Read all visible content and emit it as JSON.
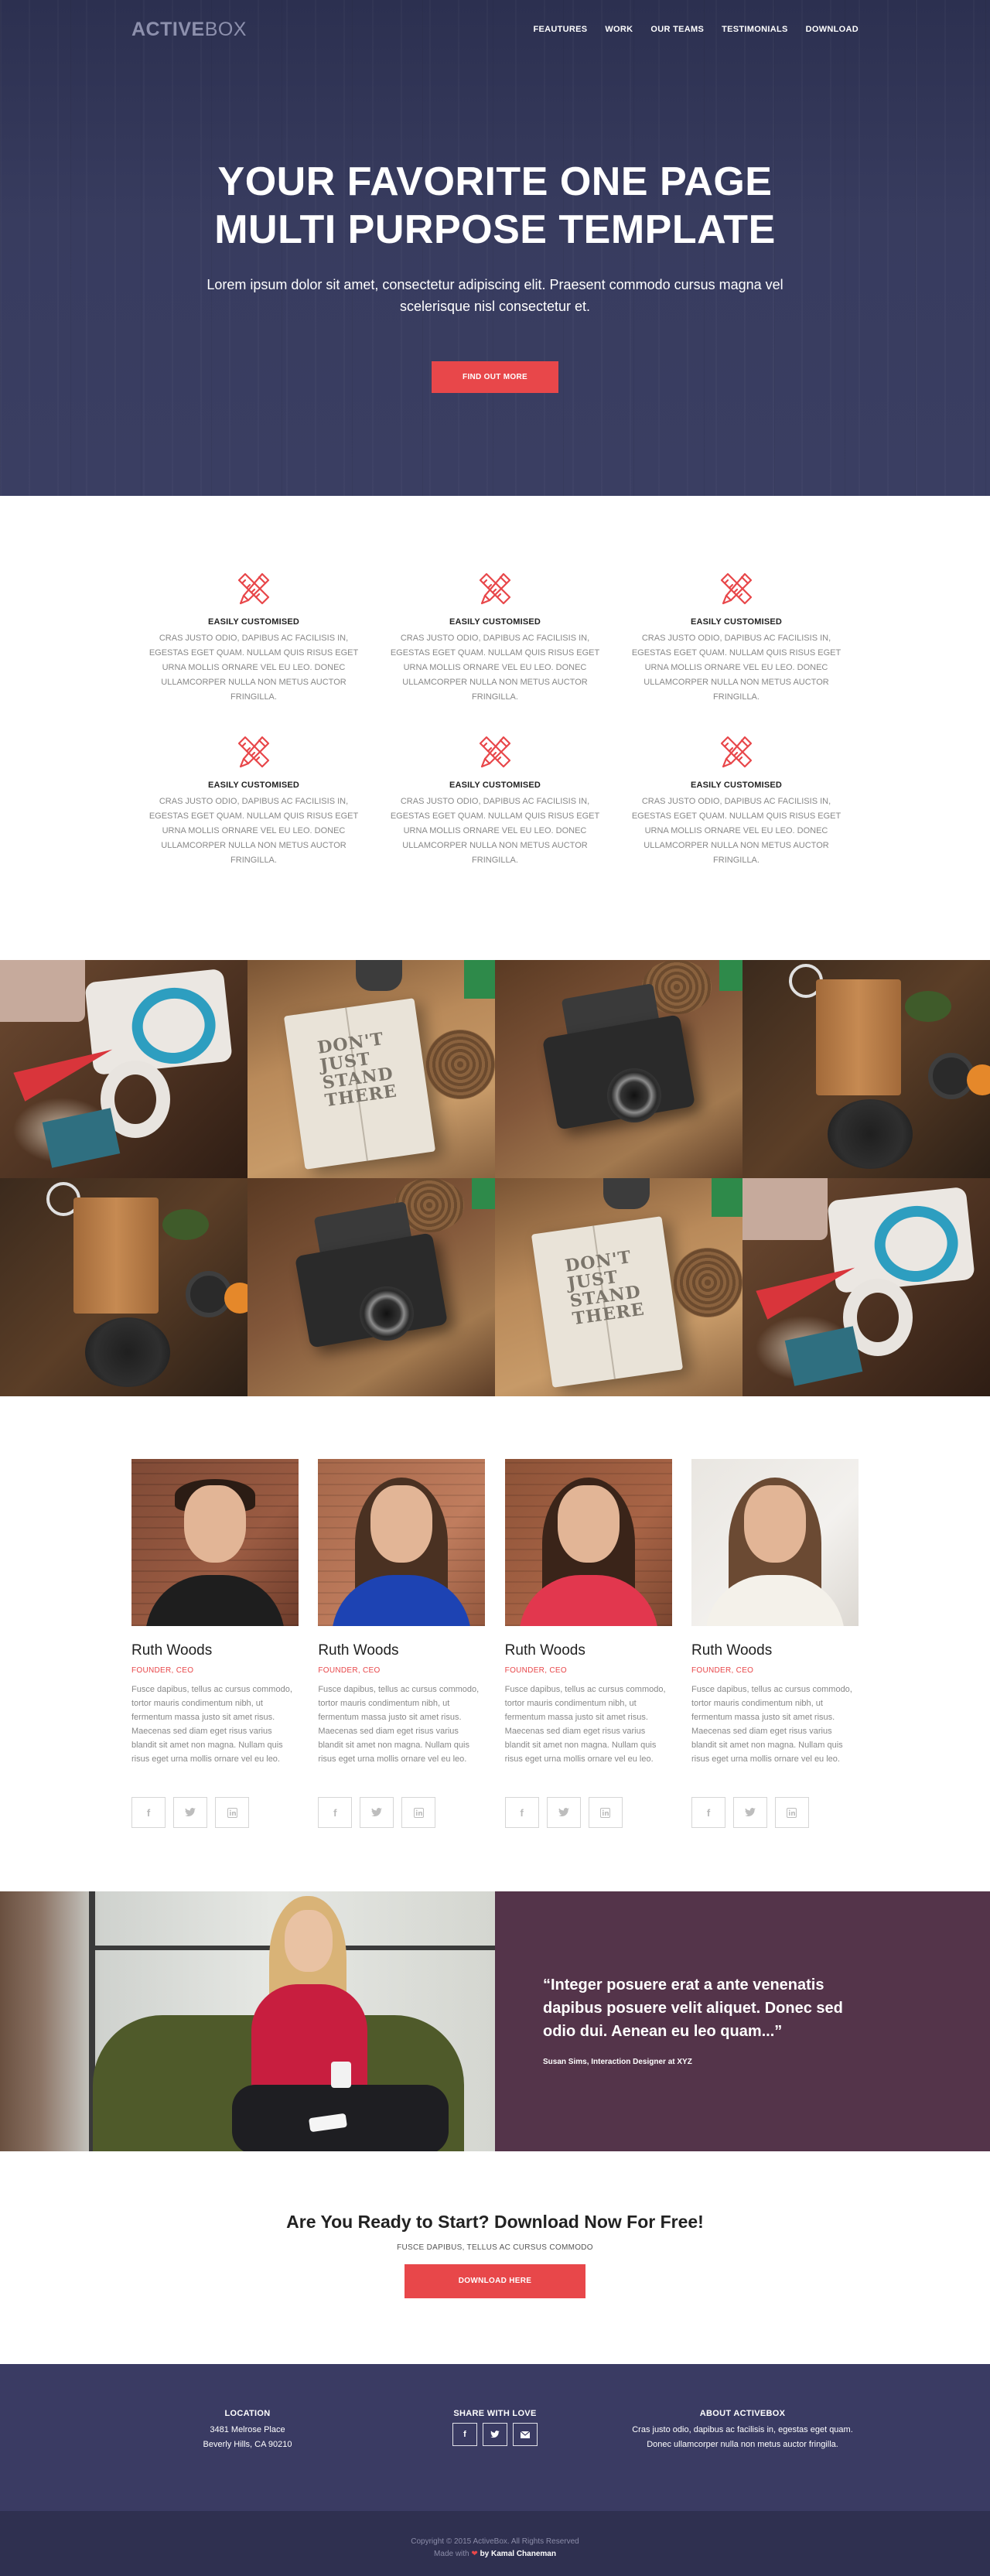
{
  "header": {
    "logo_bold": "ACTIVE",
    "logo_light": "BOX",
    "nav": [
      "FEAUTURES",
      "WORK",
      "OUR TEAMS",
      "TESTIMONIALS",
      "DOWNLOAD"
    ]
  },
  "hero": {
    "title": "YOUR FAVORITE ONE PAGE MULTI PURPOSE TEMPLATE",
    "subtitle": "Lorem ipsum dolor sit amet, consectetur adipiscing elit. Praesent commodo cursus magna vel scelerisque nisl consectetur et.",
    "button_label": "FIND OUT MORE"
  },
  "features": {
    "icon": "pencil-ruler-icon",
    "items": [
      {
        "title": "EASILY CUSTOMISED",
        "text": "Cras justo odio, dapibus ac facilisis in, egestas eget quam. Nullam quis risus eget urna mollis ornare vel eu leo. Donec ullamcorper nulla non metus auctor fringilla."
      },
      {
        "title": "EASILY CUSTOMISED",
        "text": "Cras justo odio, dapibus ac facilisis in, egestas eget quam. Nullam quis risus eget urna mollis ornare vel eu leo. Donec ullamcorper nulla non metus auctor fringilla."
      },
      {
        "title": "EASILY CUSTOMISED",
        "text": "Cras justo odio, dapibus ac facilisis in, egestas eget quam. Nullam quis risus eget urna mollis ornare vel eu leo. Donec ullamcorper nulla non metus auctor fringilla."
      },
      {
        "title": "EASILY CUSTOMISED",
        "text": "Cras justo odio, dapibus ac facilisis in, egestas eget quam. Nullam quis risus eget urna mollis ornare vel eu leo. Donec ullamcorper nulla non metus auctor fringilla."
      },
      {
        "title": "EASILY CUSTOMISED",
        "text": "Cras justo odio, dapibus ac facilisis in, egestas eget quam. Nullam quis risus eget urna mollis ornare vel eu leo. Donec ullamcorper nulla non metus auctor fringilla."
      },
      {
        "title": "EASILY CUSTOMISED",
        "text": "Cras justo odio, dapibus ac facilisis in, egestas eget quam. Nullam quis risus eget urna mollis ornare vel eu leo. Donec ullamcorper nulla non metus auctor fringilla."
      }
    ]
  },
  "gallery": {
    "book_text": "DON'T JUST STAND THERE"
  },
  "team": {
    "members": [
      {
        "name": "Ruth Woods",
        "role": "FOUNDER, CEO",
        "bio": "Fusce dapibus, tellus ac cursus commodo, tortor mauris condimentum nibh, ut fermentum massa justo sit amet risus. Maecenas sed diam eget risus varius blandit sit amet non magna. Nullam quis risus eget urna mollis ornare vel eu leo."
      },
      {
        "name": "Ruth Woods",
        "role": "FOUNDER, CEO",
        "bio": "Fusce dapibus, tellus ac cursus commodo, tortor mauris condimentum nibh, ut fermentum massa justo sit amet risus. Maecenas sed diam eget risus varius blandit sit amet non magna. Nullam quis risus eget urna mollis ornare vel eu leo."
      },
      {
        "name": "Ruth Woods",
        "role": "FOUNDER, CEO",
        "bio": "Fusce dapibus, tellus ac cursus commodo, tortor mauris condimentum nibh, ut fermentum massa justo sit amet risus. Maecenas sed diam eget risus varius blandit sit amet non magna. Nullam quis risus eget urna mollis ornare vel eu leo."
      },
      {
        "name": "Ruth Woods",
        "role": "FOUNDER, CEO",
        "bio": "Fusce dapibus, tellus ac cursus commodo, tortor mauris condimentum nibh, ut fermentum massa justo sit amet risus. Maecenas sed diam eget risus varius blandit sit amet non magna. Nullam quis risus eget urna mollis ornare vel eu leo."
      }
    ],
    "social_icons": [
      "facebook-icon",
      "twitter-icon",
      "linkedin-icon"
    ]
  },
  "testimonial": {
    "quote": "“Integer posuere erat a ante venenatis dapibus posuere velit aliquet. Donec sed odio dui. Aenean eu leo quam...”",
    "author": "Susan Sims, Interaction Designer at XYZ"
  },
  "cta": {
    "title": "Are You Ready to Start? Download Now For Free!",
    "subtitle": "FUSCE DAPIBUS, TELLUS AC CURSUS COMMODO",
    "button_label": "DOWNLOAD HERE"
  },
  "footer": {
    "location_title": "LOCATION",
    "location_lines": [
      "3481 Melrose Place",
      "Beverly Hills, CA 90210"
    ],
    "share_title": "SHARE WITH LOVE",
    "share_icons": [
      "facebook-icon",
      "twitter-icon",
      "email-icon"
    ],
    "about_title": "ABOUT ACTIVEBOX",
    "about_lines": [
      "Cras justo odio, dapibus ac facilisis in, egestas eget quam.",
      "Donec ullamcorper nulla non metus auctor fringilla."
    ],
    "copyright": "Copyright © 2015 ActiveBox. All Rights Reserved",
    "made_with": "Made with",
    "made_by": "by Kamal Chaneman"
  },
  "colors": {
    "accent": "#e8474a",
    "hero_bg": "#34385a",
    "testimonial_bg": "#54344a",
    "footer_bg": "#3a3b63",
    "copyright_bg": "#2f3050"
  }
}
